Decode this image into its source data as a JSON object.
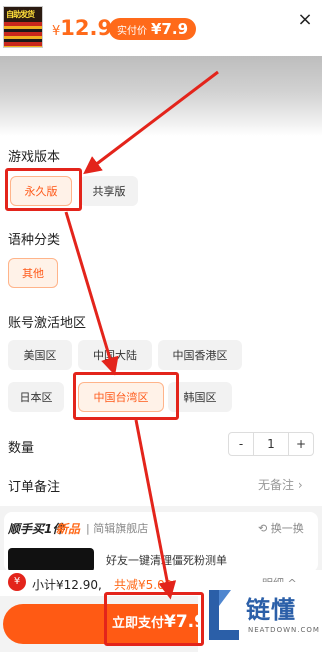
{
  "header": {
    "thumb_text": "自助发货",
    "price_symbol": "¥",
    "price": "12.9",
    "actual_label": "实付价",
    "actual_value": "¥7.9",
    "close": "×"
  },
  "sections": {
    "version": {
      "title": "游戏版本",
      "options": [
        "永久版",
        "共享版"
      ],
      "selected": "永久版"
    },
    "language": {
      "title": "语种分类",
      "options": [
        "其他"
      ],
      "selected": "其他"
    },
    "region": {
      "title": "账号激活地区",
      "options": [
        "美国区",
        "中国大陆",
        "中国香港区",
        "日本区",
        "中国台湾区",
        "韩国区"
      ],
      "selected": "中国台湾区"
    }
  },
  "quantity": {
    "label": "数量",
    "minus": "-",
    "value": "1",
    "plus": "+"
  },
  "note": {
    "label": "订单备注",
    "value": "无备注 ›"
  },
  "bundle": {
    "title": "顺手买1件",
    "tag": "新品",
    "store": "| 简辑旗舰店",
    "swap": "⟲ 换一换",
    "item_desc": "好友一键清理僵死粉测单"
  },
  "summary": {
    "icon": "¥",
    "subtotal": "小计¥12.90,",
    "saved": "共减¥5.00",
    "detail": "明细 ^"
  },
  "pay": {
    "label": "立即支付",
    "amount": "¥7.90"
  },
  "watermark": {
    "text": "链懂",
    "sub": "NEATDOWN.COM"
  },
  "colors": {
    "accent": "#ff5a14",
    "annotation": "#e3241b"
  }
}
